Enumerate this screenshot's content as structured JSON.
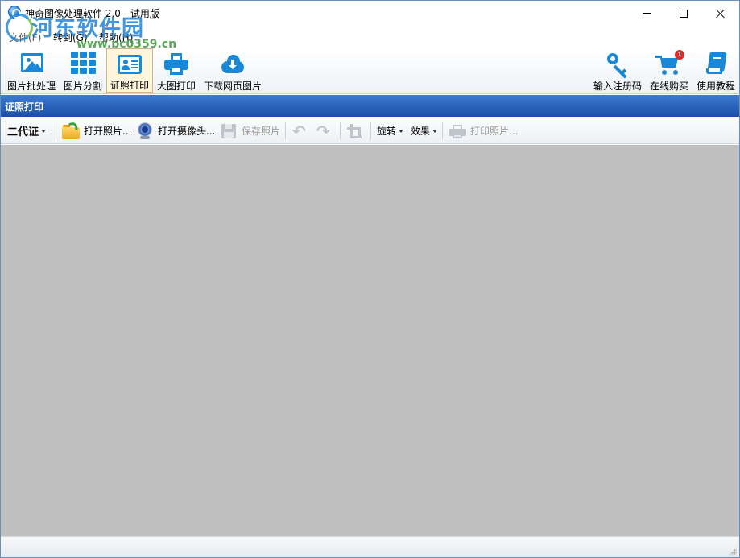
{
  "window": {
    "title": "神奇图像处理软件 2.0 - 试用版"
  },
  "menu": {
    "file": "文件(F)",
    "goto": "转到(G)",
    "help": "帮助(H)"
  },
  "watermark": {
    "name": "河东软件园",
    "url": "www.pc0359.cn"
  },
  "toolbar": {
    "batch": "图片批处理",
    "split": "图片分割",
    "id_print": "证照打印",
    "large_print": "大图打印",
    "download": "下载网页图片",
    "register": "输入注册码",
    "buy": "在线购买",
    "tutorial": "使用教程",
    "cart_badge": "1"
  },
  "section": {
    "title": "证照打印"
  },
  "toolbar2": {
    "id_type": "二代证",
    "open_photo": "打开照片...",
    "open_camera": "打开摄像头...",
    "save_photo": "保存照片",
    "rotate": "旋转",
    "effect": "效果",
    "print_photo": "打印照片..."
  },
  "colors": {
    "accent": "#1a88d8",
    "header_blue": "#1a4fa8",
    "workarea": "#c0c0c0",
    "badge": "#e02a2a"
  }
}
